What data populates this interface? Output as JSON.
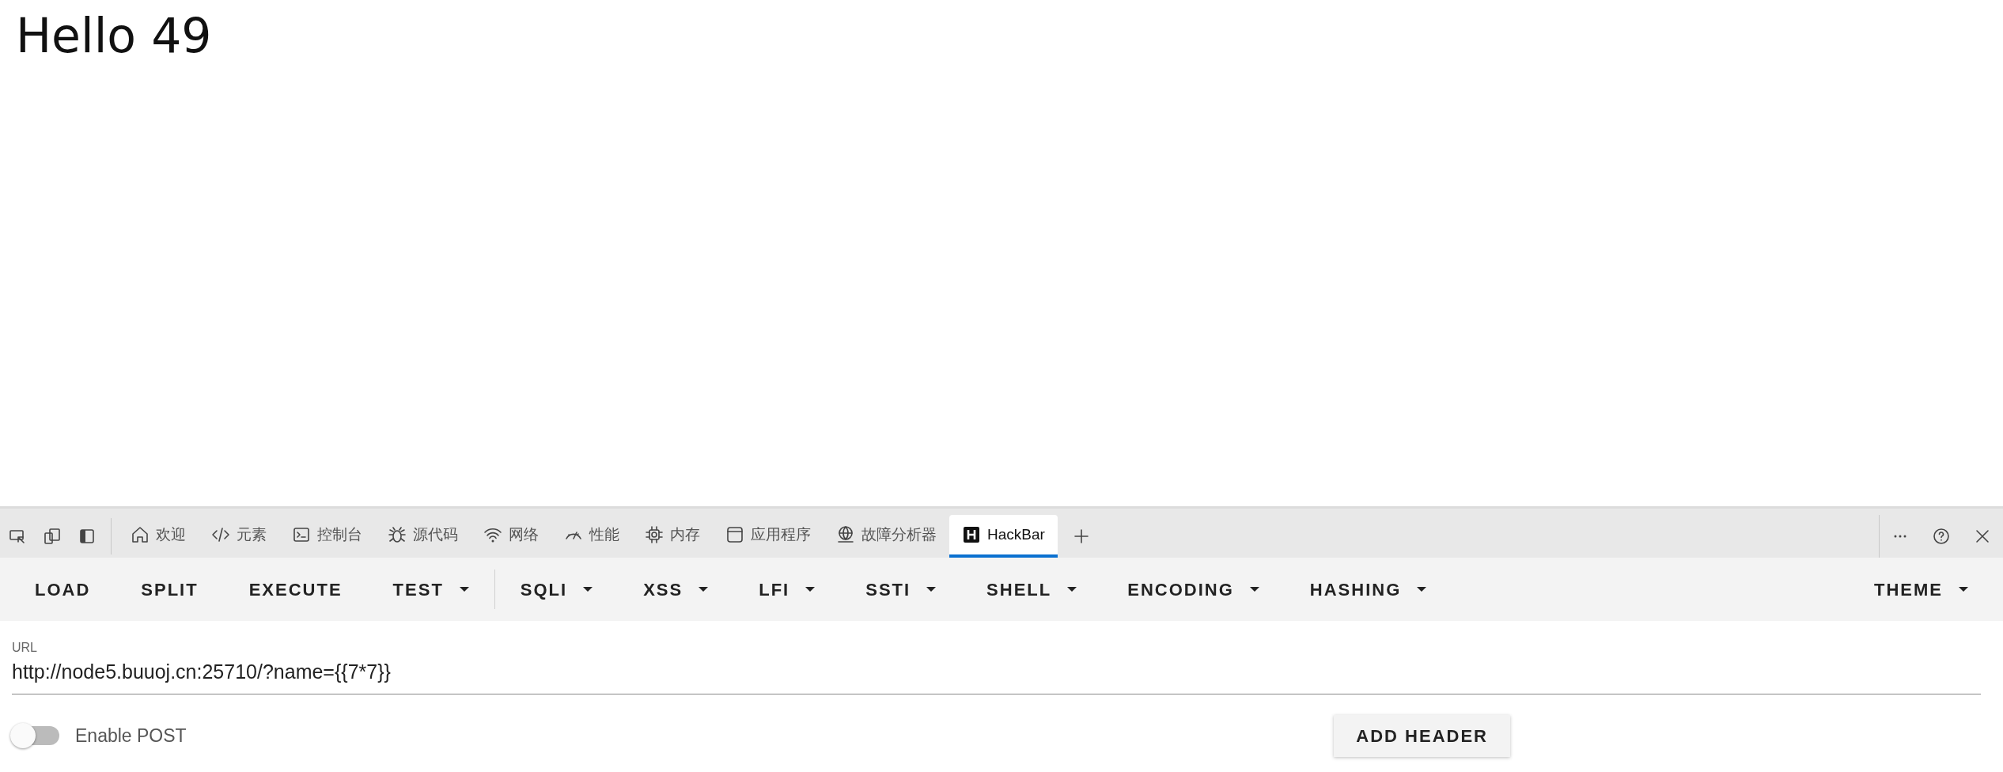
{
  "page": {
    "heading": "Hello 49"
  },
  "devtools": {
    "tabs": [
      {
        "label": "欢迎",
        "selected": false
      },
      {
        "label": "元素",
        "selected": false
      },
      {
        "label": "控制台",
        "selected": false
      },
      {
        "label": "源代码",
        "selected": false
      },
      {
        "label": "网络",
        "selected": false
      },
      {
        "label": "性能",
        "selected": false
      },
      {
        "label": "内存",
        "selected": false
      },
      {
        "label": "应用程序",
        "selected": false
      },
      {
        "label": "故障分析器",
        "selected": false
      },
      {
        "label": "HackBar",
        "selected": true
      }
    ]
  },
  "hackbar": {
    "toolbar": [
      {
        "label": "LOAD",
        "kind": "button"
      },
      {
        "label": "SPLIT",
        "kind": "button"
      },
      {
        "label": "EXECUTE",
        "kind": "button"
      },
      {
        "label": "TEST",
        "kind": "menu"
      },
      {
        "label": "SQLI",
        "kind": "menu"
      },
      {
        "label": "XSS",
        "kind": "menu"
      },
      {
        "label": "LFI",
        "kind": "menu"
      },
      {
        "label": "SSTI",
        "kind": "menu"
      },
      {
        "label": "SHELL",
        "kind": "menu"
      },
      {
        "label": "ENCODING",
        "kind": "menu"
      },
      {
        "label": "HASHING",
        "kind": "menu"
      }
    ],
    "theme": {
      "label": "THEME",
      "kind": "menu"
    },
    "url_label": "URL",
    "url_value": "http://node5.buuoj.cn:25710/?name={{7*7}}",
    "post_toggle": {
      "label": "Enable POST",
      "on": false
    },
    "add_header": "ADD HEADER"
  }
}
